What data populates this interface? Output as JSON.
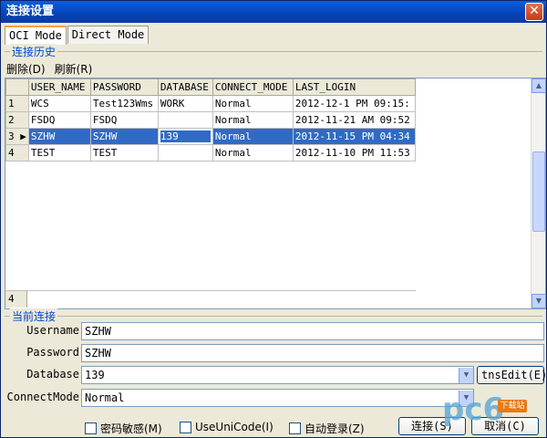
{
  "window": {
    "title": "连接设置",
    "close_symbol": "✕"
  },
  "tabs": [
    {
      "label": "OCI Mode",
      "active": true
    },
    {
      "label": "Direct Mode",
      "active": false
    }
  ],
  "history": {
    "group_title": "连接历史",
    "toolbar": {
      "delete": "删除(D)",
      "refresh": "刷新(R)"
    },
    "columns": [
      "USER_NAME",
      "PASSWORD",
      "DATABASE",
      "CONNECT_MODE",
      "LAST_LOGIN"
    ],
    "rows": [
      {
        "ind": "1",
        "user": "WCS",
        "pwd": "Test123Wms",
        "db": "WORK",
        "mode": "Normal",
        "last": "2012-12-1 PM 09:15:"
      },
      {
        "ind": "2",
        "user": "FSDQ",
        "pwd": "FSDQ",
        "db": "",
        "mode": "Normal",
        "last": "2012-11-21 AM 09:52"
      },
      {
        "ind": "3",
        "user": "SZHW",
        "pwd": "SZHW",
        "db": "139",
        "mode": "Normal",
        "last": "2012-11-15 PM 04:34"
      },
      {
        "ind": "4",
        "user": "TEST",
        "pwd": "TEST",
        "db": "",
        "mode": "Normal",
        "last": "2012-11-10 PM 11:53"
      }
    ],
    "selected_row": 2,
    "record_count": "4"
  },
  "current": {
    "group_title": "当前连接",
    "username": {
      "label": "Username",
      "value": "SZHW"
    },
    "password": {
      "label": "Password",
      "value": "SZHW"
    },
    "database": {
      "label": "Database",
      "value": "139"
    },
    "connect_mode": {
      "label": "ConnectMode",
      "value": "Normal"
    },
    "tns_edit": "tnsEdit(E)"
  },
  "options": {
    "case_sensitive": "密码敏感(M)",
    "use_unicode": "UseUniCode(I)",
    "auto_login": "自动登录(Z)"
  },
  "buttons": {
    "connect": "连接(S)",
    "cancel": "取消(C)"
  },
  "watermark": {
    "logo": "pc6",
    "badge": "下载站"
  },
  "colors": {
    "title_bar": "#0842b8",
    "selection": "#316ac5",
    "group_title": "#0046d5"
  }
}
